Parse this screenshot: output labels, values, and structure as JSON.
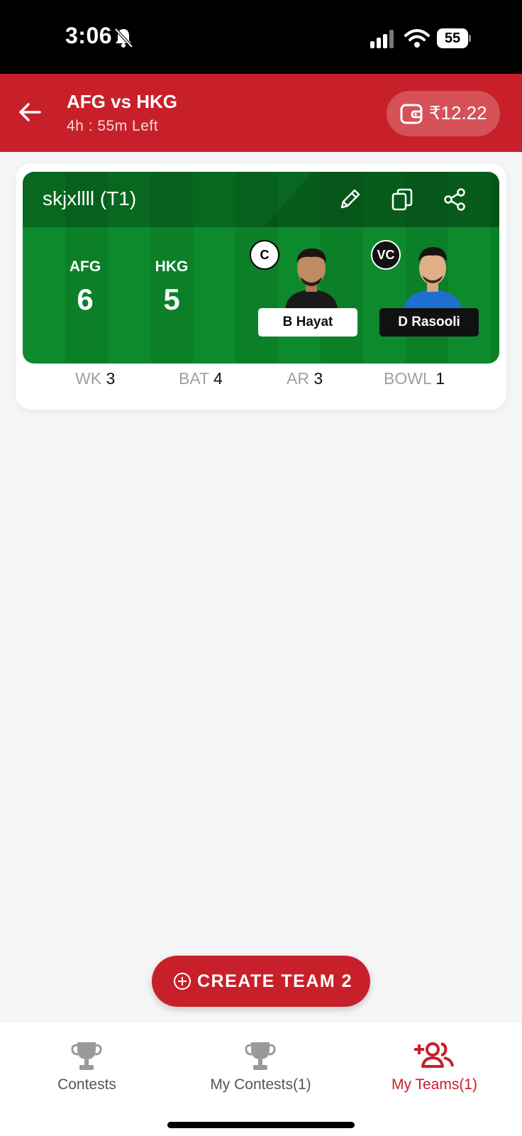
{
  "status_bar": {
    "time": "3:06",
    "battery": "55"
  },
  "header": {
    "title": "AFG vs HKG",
    "time_left": "4h : 55m Left",
    "wallet_amount": "₹12.22"
  },
  "team": {
    "name": "skjxllll (T1)",
    "sides": [
      {
        "label": "AFG",
        "count": "6"
      },
      {
        "label": "HKG",
        "count": "5"
      }
    ],
    "captain": {
      "badge": "C",
      "name": "B Hayat"
    },
    "vice_captain": {
      "badge": "VC",
      "name": "D Rasooli"
    },
    "role_counts": [
      {
        "label": "WK",
        "value": "3"
      },
      {
        "label": "BAT",
        "value": "4"
      },
      {
        "label": "AR",
        "value": "3"
      },
      {
        "label": "BOWL",
        "value": "1"
      }
    ]
  },
  "create_button": {
    "label": "CREATE TEAM 2"
  },
  "nav": {
    "items": [
      {
        "label": "Contests",
        "icon": "trophy-icon"
      },
      {
        "label": "My Contests(1)",
        "icon": "trophy-icon"
      },
      {
        "label": "My Teams(1)",
        "icon": "add-team-icon"
      }
    ]
  },
  "colors": {
    "brand": "#c8202a",
    "pitch": "#0d8a2c"
  }
}
